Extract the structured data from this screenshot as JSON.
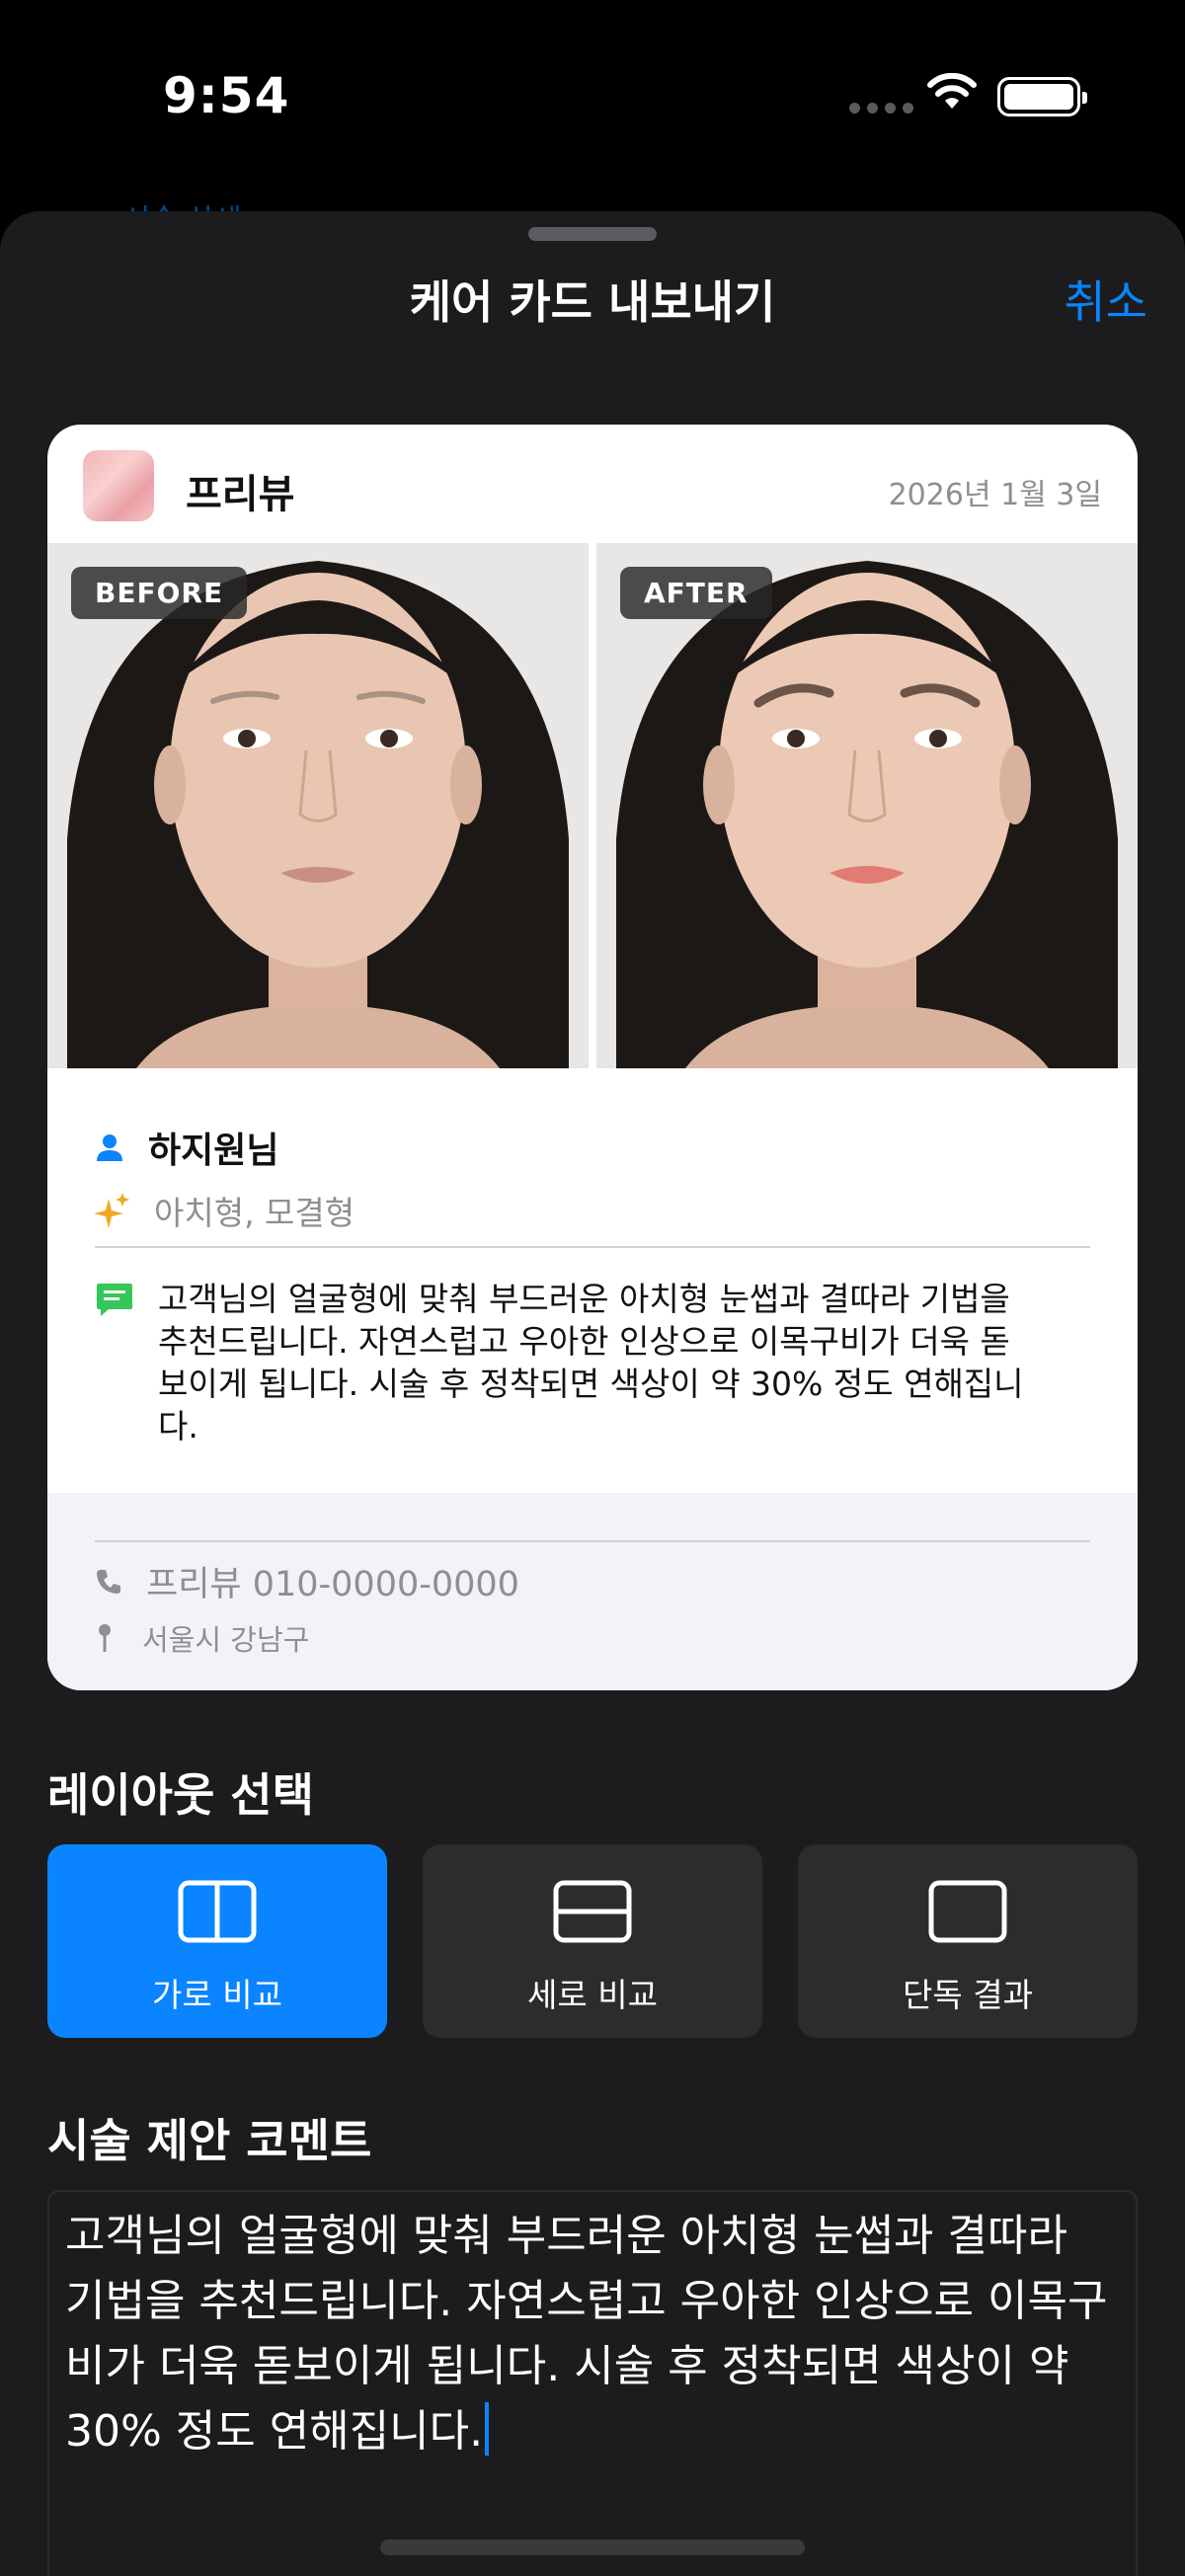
{
  "status_bar": {
    "time": "9:54"
  },
  "behind": {
    "link": "< 시술 상세"
  },
  "sheet": {
    "title": "케어 카드 내보내기",
    "cancel_label": "취소"
  },
  "card": {
    "brand": "프리뷰",
    "date": "2026년 1월 3일",
    "before_label": "BEFORE",
    "after_label": "AFTER",
    "customer_name": "하지원님",
    "styles": "아치형, 모결형",
    "comment": "고객님의 얼굴형에 맞춰 부드러운 아치형 눈썹과 결따라 기법을 추천드립니다. 자연스럽고 우아한 인상으로 이목구비가 더욱 돋보이게 됩니다. 시술 후 정착되면 색상이 약 30% 정도 연해집니다.",
    "phone": "프리뷰 010-0000-0000",
    "address": "서울시 강남구"
  },
  "layout": {
    "title": "레이아웃 선택",
    "options": [
      {
        "label": "가로 비교",
        "icon": "split-horizontal-icon",
        "selected": true
      },
      {
        "label": "세로 비교",
        "icon": "split-vertical-icon",
        "selected": false
      },
      {
        "label": "단독 결과",
        "icon": "single-frame-icon",
        "selected": false
      }
    ]
  },
  "comment_section": {
    "title": "시술 제안 코멘트",
    "value": "고객님의 얼굴형에 맞춰 부드러운 아치형 눈썹과 결따라 기법을 추천드립니다. 자연스럽고 우아한 인상으로 이목구비가 더욱 돋보이게 됩니다. 시술 후 정착되면 색상이 약 30% 정도 연해집니다."
  },
  "colors": {
    "accent": "#0a84ff",
    "sheet_bg": "#1c1c1e",
    "option_bg": "#2c2c2e"
  }
}
